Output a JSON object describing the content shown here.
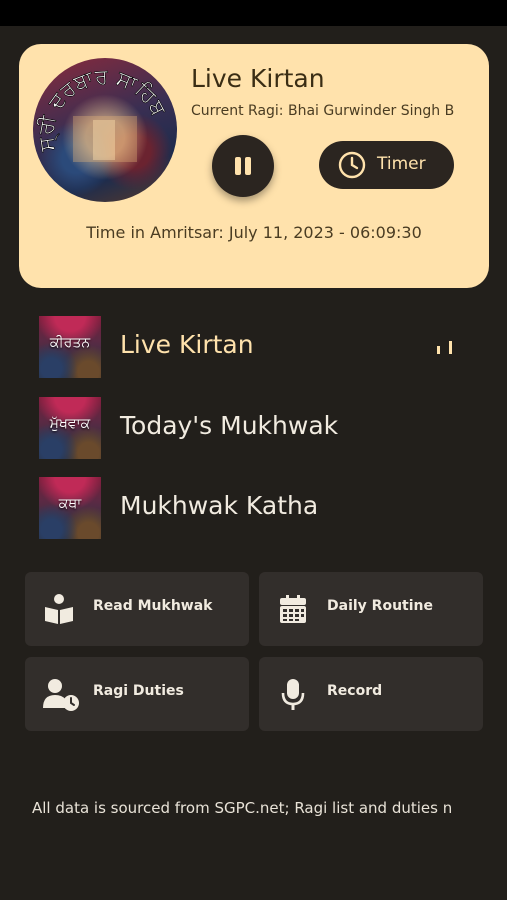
{
  "now_playing": {
    "title": "Live Kirtan",
    "ragi": "Current Ragi: Bhai Gurwinder Singh B",
    "timer_label": "Timer",
    "time": "Time in Amritsar: July 11, 2023 - 06:09:30",
    "cover_text": "ਸ੍ਰੀ ਦਰਬਾਰ ਸਾਹਿਬ"
  },
  "tracks": [
    {
      "thumb_text": "ਕੀਰਤਨ",
      "title": "Live Kirtan",
      "playing": true
    },
    {
      "thumb_text": "ਮੁੱਖਵਾਕ",
      "title": "Today's Mukhwak",
      "playing": false
    },
    {
      "thumb_text": "ਕਥਾ",
      "title": "Mukhwak Katha",
      "playing": false
    }
  ],
  "actions": [
    {
      "label": "Read Mukhwak",
      "icon": "book-reader-icon"
    },
    {
      "label": "Daily Routine",
      "icon": "calendar-icon"
    },
    {
      "label": "Ragi Duties",
      "icon": "user-clock-icon"
    },
    {
      "label": "Record",
      "icon": "microphone-icon"
    }
  ],
  "footer": {
    "text": "All data is sourced from SGPC.net; Ragi list and duties n"
  },
  "colors": {
    "background": "#221f1b",
    "card": "#ffe2ac",
    "accent": "#ffe2ac",
    "tile": "#322e2b"
  }
}
